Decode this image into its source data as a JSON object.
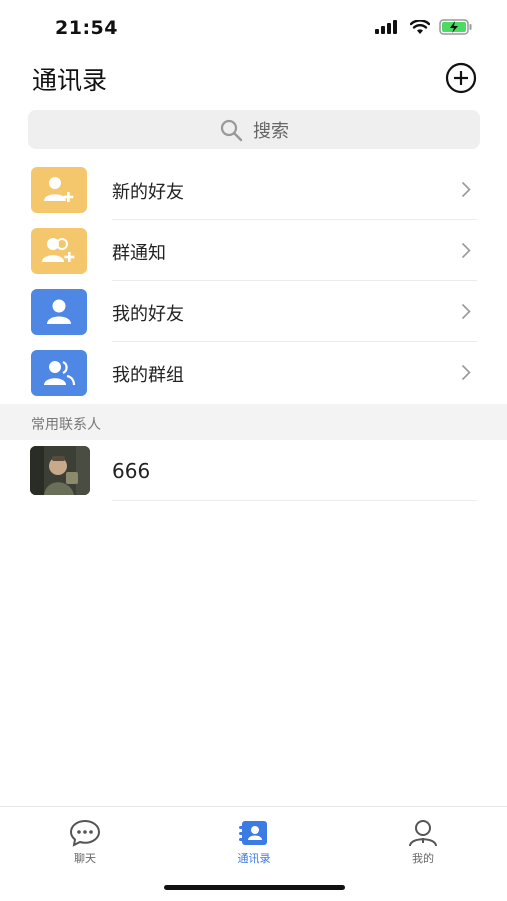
{
  "status": {
    "time": "21:54",
    "icons": [
      "signal-icon",
      "wifi-icon",
      "battery-charging-icon"
    ]
  },
  "header": {
    "title": "通讯录",
    "add_icon": "add-circle-icon"
  },
  "search": {
    "placeholder": "搜索",
    "icon": "search-icon"
  },
  "menu": [
    {
      "label": "新的好友",
      "icon": "user-add-icon",
      "color": "#f5c76d"
    },
    {
      "label": "群通知",
      "icon": "group-add-icon",
      "color": "#f5c76d"
    },
    {
      "label": "我的好友",
      "icon": "user-icon",
      "color": "#4f87e5"
    },
    {
      "label": "我的群组",
      "icon": "group-icon",
      "color": "#4f87e5"
    }
  ],
  "section": {
    "title": "常用联系人"
  },
  "contacts": [
    {
      "name": "666",
      "avatar": "avatar-photo"
    }
  ],
  "tabbar": {
    "tabs": [
      {
        "label": "聊天",
        "icon": "chat-bubble-icon",
        "active": false
      },
      {
        "label": "通讯录",
        "icon": "contacts-book-icon",
        "active": true
      },
      {
        "label": "我的",
        "icon": "profile-icon",
        "active": false
      }
    ],
    "active_color": "#3c7ae4"
  }
}
